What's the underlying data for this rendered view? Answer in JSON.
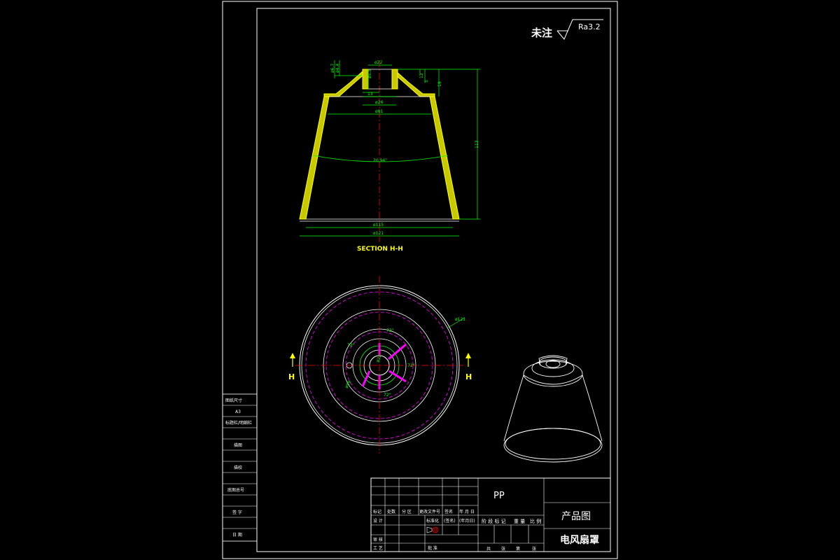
{
  "roughness": {
    "note": "未注",
    "symbol": "Ra3.2"
  },
  "section": {
    "title": "SECTION H-H",
    "dims": {
      "d22": "ø22",
      "d26": "ø26",
      "d81": "ø81",
      "d115": "ø115",
      "d121": "ø121",
      "d6_7": "ø6.7",
      "d4_4": "ø4.4",
      "d5_5": "ø5.5",
      "l13": "13",
      "l12": "12",
      "l5": "5",
      "l19": "19",
      "l113": "113",
      "angle": "20.94°"
    }
  },
  "plan": {
    "section_mark": "H",
    "dims": {
      "d121": "ø121",
      "d22": "ø22",
      "d59": "ø59",
      "a1": "72°",
      "a2": "72°",
      "a3": "72°",
      "a4": "72°"
    }
  },
  "side_table": {
    "rows": [
      "图纸尺寸",
      "A3",
      "标题栏/明细栏",
      "",
      "描图",
      "",
      "描校",
      "",
      "底图总号",
      "",
      "签 字",
      "",
      "日 期"
    ]
  },
  "title_block": {
    "material": "PP",
    "drawing_type": "产品图",
    "product_name": "电风扇罩",
    "header_row": [
      "标记",
      "处数",
      "分 区",
      "更改文件号",
      "签名",
      "年 月 日"
    ],
    "design_row": [
      "设 计",
      "",
      "",
      "标准化",
      "(签名)",
      "(年月日)"
    ],
    "review_row": [
      "审 核",
      "",
      ""
    ],
    "craft_row": [
      "工 艺",
      "",
      "",
      "批 准"
    ],
    "stage_labels": [
      "阶 段 标 记",
      "重 量",
      "比 例"
    ],
    "sheet_labels": [
      "共",
      "张",
      "第",
      "张"
    ]
  }
}
